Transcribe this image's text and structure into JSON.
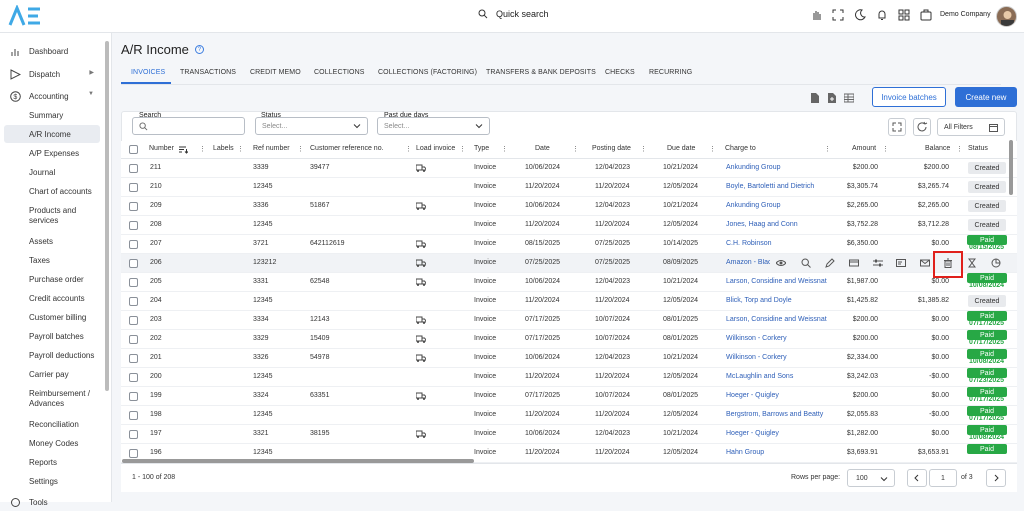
{
  "header": {
    "logo": "AE",
    "quick_search": "Quick search",
    "company": "Demo Company"
  },
  "sidebar": {
    "items": [
      {
        "label": "Dashboard",
        "icon": "bar-chart-icon"
      },
      {
        "label": "Dispatch",
        "icon": "send-icon",
        "arrow": "▶"
      },
      {
        "label": "Accounting",
        "icon": "dollar-icon",
        "arrow": "▼"
      },
      {
        "label": "Summary"
      },
      {
        "label": "A/R Income"
      },
      {
        "label": "A/P Expenses"
      },
      {
        "label": "Journal"
      },
      {
        "label": "Chart of accounts"
      },
      {
        "label": "Products and services"
      },
      {
        "label": "Assets"
      },
      {
        "label": "Taxes"
      },
      {
        "label": "Purchase order"
      },
      {
        "label": "Credit accounts"
      },
      {
        "label": "Customer billing"
      },
      {
        "label": "Payroll batches"
      },
      {
        "label": "Payroll deductions"
      },
      {
        "label": "Carrier pay"
      },
      {
        "label": "Reimbursement / Advances"
      },
      {
        "label": "Reconciliation"
      },
      {
        "label": "Money Codes"
      },
      {
        "label": "Reports"
      },
      {
        "label": "Settings"
      },
      {
        "label": "Tools"
      }
    ]
  },
  "page": {
    "title": "A/R Income",
    "help": "?"
  },
  "tabs": [
    "INVOICES",
    "TRANSACTIONS",
    "CREDIT MEMO",
    "COLLECTIONS",
    "COLLECTIONS (FACTORING)",
    "TRANSFERS & BANK DEPOSITS",
    "CHECKS",
    "RECURRING"
  ],
  "actions": {
    "invoice_batches": "Invoice batches",
    "create_new": "Create new"
  },
  "filters": {
    "search_label": "Search",
    "status_label": "Status",
    "status_placeholder": "Select...",
    "pastdue_label": "Past due days",
    "pastdue_placeholder": "Select...",
    "all_filters": "All Filters"
  },
  "columns": [
    "Number",
    "Labels",
    "Ref number",
    "Customer reference no.",
    "Load invoice",
    "Type",
    "Date",
    "Posting date",
    "Due date",
    "Charge to",
    "Amount",
    "Balance",
    "Status"
  ],
  "rows": [
    {
      "num": "211",
      "ref": "3339",
      "cust": "39477",
      "truck": true,
      "type": "Invoice",
      "date": "10/06/2024",
      "post": "12/04/2023",
      "due": "10/21/2024",
      "charge": "Ankunding Group",
      "amount": "$200.00",
      "balance": "$200.00",
      "status": "Created",
      "pdate": ""
    },
    {
      "num": "210",
      "ref": "12345",
      "cust": "",
      "truck": false,
      "type": "Invoice",
      "date": "11/20/2024",
      "post": "11/20/2024",
      "due": "12/05/2024",
      "charge": "Boyle, Bartoletti and Dietrich",
      "amount": "$3,305.74",
      "balance": "$3,265.74",
      "status": "Created",
      "pdate": ""
    },
    {
      "num": "209",
      "ref": "3336",
      "cust": "51867",
      "truck": true,
      "type": "Invoice",
      "date": "10/06/2024",
      "post": "12/04/2023",
      "due": "10/21/2024",
      "charge": "Ankunding Group",
      "amount": "$2,265.00",
      "balance": "$2,265.00",
      "status": "Created",
      "pdate": ""
    },
    {
      "num": "208",
      "ref": "12345",
      "cust": "",
      "truck": false,
      "type": "Invoice",
      "date": "11/20/2024",
      "post": "11/20/2024",
      "due": "12/05/2024",
      "charge": "Jones, Haag and Conn",
      "amount": "$3,752.28",
      "balance": "$3,712.28",
      "status": "Created",
      "pdate": ""
    },
    {
      "num": "207",
      "ref": "3721",
      "cust": "642112619",
      "truck": true,
      "type": "Invoice",
      "date": "08/15/2025",
      "post": "07/25/2025",
      "due": "10/14/2025",
      "charge": "C.H. Robinson",
      "amount": "$6,350.00",
      "balance": "$0.00",
      "status": "Paid",
      "pdate": "08/15/2025"
    },
    {
      "num": "206",
      "ref": "123212",
      "cust": "",
      "truck": true,
      "type": "Invoice",
      "date": "07/25/2025",
      "post": "07/25/2025",
      "due": "08/09/2025",
      "charge": "Amazon - Blac",
      "amount": "",
      "balance": "",
      "status": "",
      "pdate": "",
      "hover": true
    },
    {
      "num": "205",
      "ref": "3331",
      "cust": "62548",
      "truck": true,
      "type": "Invoice",
      "date": "10/06/2024",
      "post": "12/04/2023",
      "due": "10/21/2024",
      "charge": "Larson, Considine and Weissnat",
      "amount": "$1,987.00",
      "balance": "$0.00",
      "status": "Paid",
      "pdate": "10/08/2024"
    },
    {
      "num": "204",
      "ref": "12345",
      "cust": "",
      "truck": false,
      "type": "Invoice",
      "date": "11/20/2024",
      "post": "11/20/2024",
      "due": "12/05/2024",
      "charge": "Blick, Torp and Doyle",
      "amount": "$1,425.82",
      "balance": "$1,385.82",
      "status": "Created",
      "pdate": ""
    },
    {
      "num": "203",
      "ref": "3334",
      "cust": "12143",
      "truck": true,
      "type": "Invoice",
      "date": "07/17/2025",
      "post": "10/07/2024",
      "due": "08/01/2025",
      "charge": "Larson, Considine and Weissnat",
      "amount": "$200.00",
      "balance": "$0.00",
      "status": "Paid",
      "pdate": "07/17/2025"
    },
    {
      "num": "202",
      "ref": "3329",
      "cust": "15409",
      "truck": true,
      "type": "Invoice",
      "date": "07/17/2025",
      "post": "10/07/2024",
      "due": "08/01/2025",
      "charge": "Wilkinson - Corkery",
      "amount": "$200.00",
      "balance": "$0.00",
      "status": "Paid",
      "pdate": "07/17/2025"
    },
    {
      "num": "201",
      "ref": "3326",
      "cust": "54978",
      "truck": true,
      "type": "Invoice",
      "date": "10/06/2024",
      "post": "12/04/2023",
      "due": "10/21/2024",
      "charge": "Wilkinson - Corkery",
      "amount": "$2,334.00",
      "balance": "$0.00",
      "status": "Paid",
      "pdate": "10/08/2024"
    },
    {
      "num": "200",
      "ref": "12345",
      "cust": "",
      "truck": false,
      "type": "Invoice",
      "date": "11/20/2024",
      "post": "11/20/2024",
      "due": "12/05/2024",
      "charge": "McLaughlin and Sons",
      "amount": "$3,242.03",
      "balance": "-$0.00",
      "status": "Paid",
      "pdate": "07/23/2025"
    },
    {
      "num": "199",
      "ref": "3324",
      "cust": "63351",
      "truck": true,
      "type": "Invoice",
      "date": "07/17/2025",
      "post": "10/07/2024",
      "due": "08/01/2025",
      "charge": "Hoeger - Quigley",
      "amount": "$200.00",
      "balance": "$0.00",
      "status": "Paid",
      "pdate": "07/17/2025"
    },
    {
      "num": "198",
      "ref": "12345",
      "cust": "",
      "truck": false,
      "type": "Invoice",
      "date": "11/20/2024",
      "post": "11/20/2024",
      "due": "12/05/2024",
      "charge": "Bergstrom, Barrows and Beatty",
      "amount": "$2,055.83",
      "balance": "-$0.00",
      "status": "Paid",
      "pdate": "07/17/2025"
    },
    {
      "num": "197",
      "ref": "3321",
      "cust": "38195",
      "truck": true,
      "type": "Invoice",
      "date": "10/06/2024",
      "post": "12/04/2023",
      "due": "10/21/2024",
      "charge": "Hoeger - Quigley",
      "amount": "$1,282.00",
      "balance": "$0.00",
      "status": "Paid",
      "pdate": "10/08/2024"
    },
    {
      "num": "196",
      "ref": "12345",
      "cust": "",
      "truck": false,
      "type": "Invoice",
      "date": "11/20/2024",
      "post": "11/20/2024",
      "due": "12/05/2024",
      "charge": "Hahn Group",
      "amount": "$3,693.91",
      "balance": "$3,653.91",
      "status": "Paid",
      "pdate": ""
    }
  ],
  "footer": {
    "range": "1 - 100 of 208",
    "rows_per_page_label": "Rows per page:",
    "rows_per_page": "100",
    "page": "1",
    "of": "of 3"
  },
  "colors": {
    "accent": "#2e6fd6",
    "paid": "#27a845",
    "highlight": "#e0201b"
  }
}
